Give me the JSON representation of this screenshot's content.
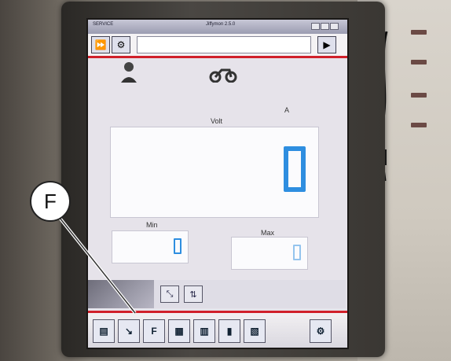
{
  "window": {
    "title": "Jiffymon 2.5.0",
    "left_label": "SERVICE"
  },
  "toolbar": {
    "fast_forward_icon": "fast-forward-icon",
    "tool_icon": "tool-icon",
    "play_icon": "play-icon"
  },
  "header_icons": {
    "operator_icon": "operator-icon",
    "vehicle_icon": "motorcycle-icon"
  },
  "readout": {
    "unit": "A",
    "main_label": "Volt",
    "main_value": "0",
    "min_label": "Min",
    "min_value": "0",
    "max_label": "Max",
    "max_value": "0"
  },
  "bottom_toolbar": {
    "f_button": "F",
    "buttons": [
      "chart-icon",
      "arrow-icon",
      "f-icon",
      "grid-icon",
      "table-icon",
      "bars-icon",
      "book-icon",
      "motorcycle-icon"
    ]
  },
  "annotation": {
    "callout": "F"
  }
}
